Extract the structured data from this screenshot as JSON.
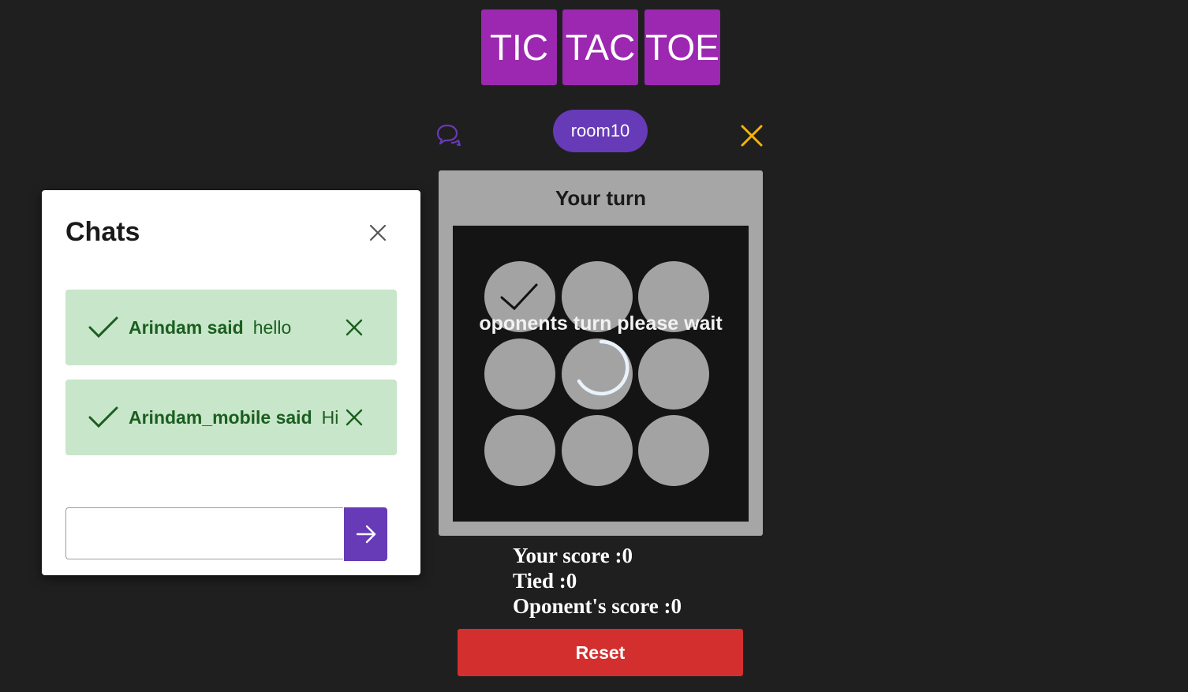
{
  "title": {
    "tiles": [
      "TIC",
      "TAC",
      "TOE"
    ]
  },
  "room": {
    "name": "room10"
  },
  "board": {
    "turn_label": "Your turn",
    "waiting_text": "oponents turn please wait",
    "cells": [
      "check",
      "",
      "",
      "",
      "",
      "",
      "",
      "",
      ""
    ]
  },
  "scores": {
    "yours": "Your score :0",
    "tied": "Tied :0",
    "opponent": "Oponent's score :0"
  },
  "reset_label": "Reset",
  "chat": {
    "title": "Chats",
    "messages": [
      {
        "sender": "Arindam said",
        "text": "hello"
      },
      {
        "sender": "Arindam_mobile said",
        "text": "Hi"
      }
    ],
    "input_value": "",
    "input_placeholder": ""
  },
  "colors": {
    "background": "#1f1f1f",
    "title_tile": "#9c27b0",
    "room_chip": "#673ab7",
    "leave_icon": "#ffb300",
    "reset": "#d32f2f",
    "message_bg": "#c8e6c9",
    "message_text": "#1b5e20"
  }
}
